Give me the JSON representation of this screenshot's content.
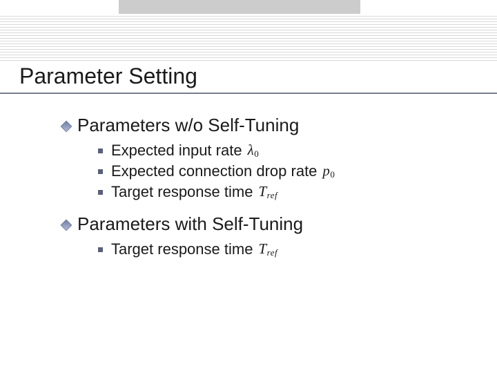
{
  "title": "Parameter Setting",
  "sections": [
    {
      "heading": "Parameters w/o Self-Tuning",
      "items": [
        {
          "text": "Expected input rate",
          "symbol": "λ",
          "sub": "0"
        },
        {
          "text": "Expected connection drop rate",
          "symbol": "p",
          "sub": "0"
        },
        {
          "text": "Target response time",
          "symbol": "T",
          "sub": "ref"
        }
      ]
    },
    {
      "heading": "Parameters with Self-Tuning",
      "items": [
        {
          "text": "Target response time",
          "symbol": "T",
          "sub": "ref"
        }
      ]
    }
  ]
}
